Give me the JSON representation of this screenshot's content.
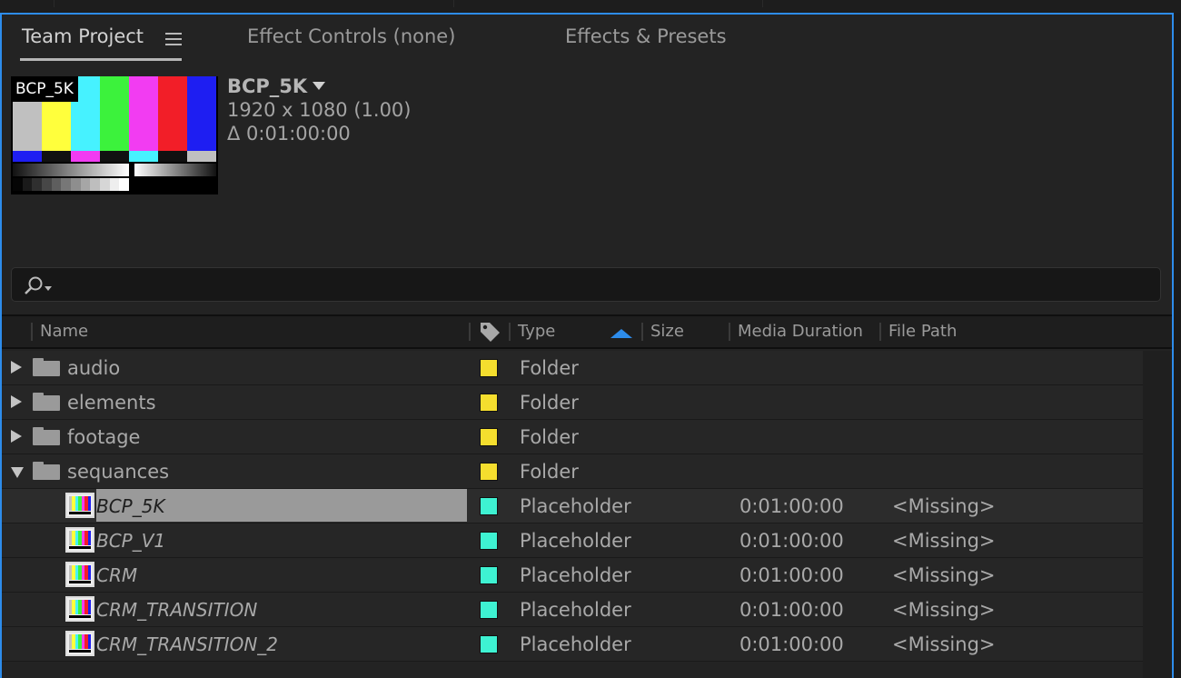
{
  "tabs": [
    {
      "label": "Team Project",
      "active": true
    },
    {
      "label": "Effect Controls (none)",
      "active": false
    },
    {
      "label": "Effects & Presets",
      "active": false
    }
  ],
  "preview": {
    "thumb_label": "BCP_5K",
    "name": "BCP_5K",
    "dimensions": "1920 x 1080 (1.00)",
    "duration": "Δ 0:01:00:00"
  },
  "search": {
    "placeholder": "",
    "value": ""
  },
  "columns": {
    "name": "Name",
    "type": "Type",
    "size": "Size",
    "media_duration": "Media Duration",
    "file_path": "File Path",
    "sort_column": "Type",
    "sort_direction": "ascending"
  },
  "items": [
    {
      "kind": "folder",
      "name": "audio",
      "expanded": false,
      "label_color": "#f5de2e",
      "type": "Folder",
      "duration": "",
      "path": ""
    },
    {
      "kind": "folder",
      "name": "elements",
      "expanded": false,
      "label_color": "#f5de2e",
      "type": "Folder",
      "duration": "",
      "path": ""
    },
    {
      "kind": "folder",
      "name": "footage",
      "expanded": false,
      "label_color": "#f5de2e",
      "type": "Folder",
      "duration": "",
      "path": ""
    },
    {
      "kind": "folder",
      "name": "sequances",
      "expanded": true,
      "label_color": "#f5de2e",
      "type": "Folder",
      "duration": "",
      "path": ""
    },
    {
      "kind": "comp",
      "name": "BCP_5K",
      "selected": true,
      "label_color": "#3ef2d2",
      "type": "Placeholder",
      "duration": "0:01:00:00",
      "path": "<Missing>"
    },
    {
      "kind": "comp",
      "name": "BCP_V1",
      "selected": false,
      "label_color": "#3ef2d2",
      "type": "Placeholder",
      "duration": "0:01:00:00",
      "path": "<Missing>"
    },
    {
      "kind": "comp",
      "name": "CRM",
      "selected": false,
      "label_color": "#3ef2d2",
      "type": "Placeholder",
      "duration": "0:01:00:00",
      "path": "<Missing>"
    },
    {
      "kind": "comp",
      "name": "CRM_TRANSITION",
      "selected": false,
      "label_color": "#3ef2d2",
      "type": "Placeholder",
      "duration": "0:01:00:00",
      "path": "<Missing>"
    },
    {
      "kind": "comp",
      "name": "CRM_TRANSITION_2",
      "selected": false,
      "label_color": "#3ef2d2",
      "type": "Placeholder",
      "duration": "0:01:00:00",
      "path": "<Missing>"
    }
  ],
  "colors": {
    "panel_focus_border": "#2d8ceb",
    "sort_arrow": "#2d8ceb",
    "selection": "#9a9a9a"
  },
  "icons": [
    "panel-menu-icon",
    "dropdown-caret-icon",
    "search-icon",
    "tag-icon",
    "sort-ascending-icon",
    "folder-icon",
    "composition-icon",
    "disclosure-triangle-icon"
  ]
}
